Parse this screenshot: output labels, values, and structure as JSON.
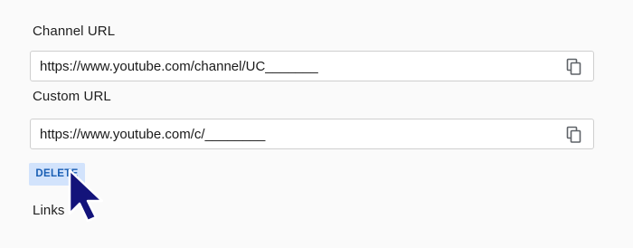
{
  "channel_url": {
    "label": "Channel URL",
    "value": "https://www.youtube.com/channel/UC_______",
    "copy_icon": "copy-icon"
  },
  "custom_url": {
    "label": "Custom URL",
    "value": "https://www.youtube.com/c/________",
    "copy_icon": "copy-icon"
  },
  "delete_label": "DELETE",
  "links_label": "Links",
  "colors": {
    "accent_text": "#1a5fb4",
    "accent_bg": "#d2e3fc",
    "cursor": "#13137a"
  }
}
